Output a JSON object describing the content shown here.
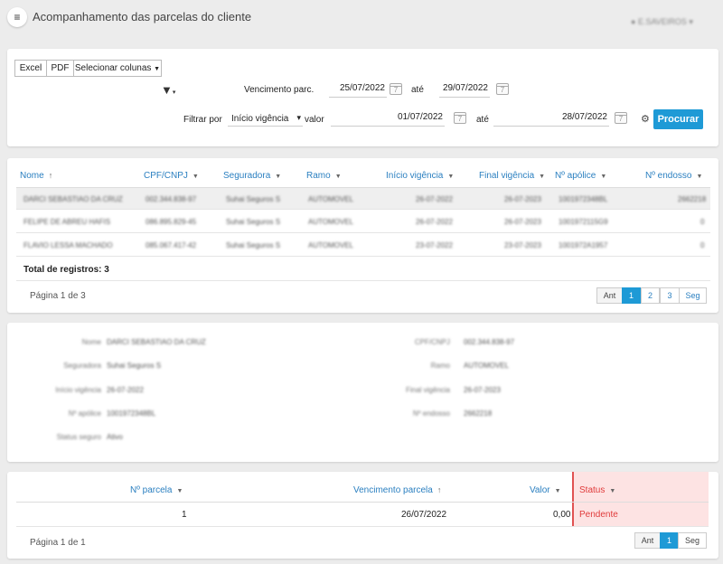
{
  "header": {
    "title": "Acompanhamento das parcelas do cliente",
    "user_name": "E.SAVEIROS"
  },
  "toolbar": {
    "excel_label": "Excel",
    "pdf_label": "PDF",
    "columns_label": "Selecionar colunas"
  },
  "filters": {
    "due_label": "Vencimento parc.",
    "due_from": "25/07/2022",
    "due_to_label": "até",
    "due_to": "29/07/2022",
    "filter_by_label": "Filtrar por",
    "filter_by_value": "Início vigência",
    "value_label": "valor",
    "value_from": "01/07/2022",
    "value_to_label": "até",
    "value_to": "28/07/2022",
    "search_label": "Procurar",
    "calendar_glyph": "7"
  },
  "clients_table": {
    "columns": [
      "Nome",
      "CPF/CNPJ",
      "Seguradora",
      "Ramo",
      "Início vigência",
      "Final vigência",
      "Nº apólice",
      "Nº endosso"
    ],
    "rows": [
      [
        "DARCI SEBASTIAO DA CRUZ",
        "002.344.838-97",
        "Suhai Seguros S",
        "AUTOMOVEL",
        "26-07-2022",
        "26-07-2023",
        "1001972348BL",
        "2662218"
      ],
      [
        "FELIPE DE ABREU HAFIS",
        "086.895.829-45",
        "Suhai Seguros S",
        "AUTOMOVEL",
        "26-07-2022",
        "26-07-2023",
        "1001972115G9",
        "0"
      ],
      [
        "FLAVIO LESSA MACHADO",
        "085.067.417-42",
        "Suhai Seguros S",
        "AUTOMOVEL",
        "23-07-2022",
        "23-07-2023",
        "1001972A1957",
        "0"
      ]
    ],
    "total_label": "Total de registros: 3",
    "page_info": "Página 1 de 3",
    "pagination": [
      "Ant",
      "1",
      "2",
      "3",
      "Seg"
    ]
  },
  "details": {
    "name_label": "Nome",
    "name_value": "DARCI SEBASTIAO DA CRUZ",
    "cpf_label": "CPF/CNPJ",
    "cpf_value": "002.344.838-97",
    "insurer_label": "Seguradora",
    "insurer_value": "Suhai Seguros S",
    "branch_label": "Ramo",
    "branch_value": "AUTOMOVEL",
    "start_label": "Início vigência",
    "start_value": "26-07-2022",
    "end_label": "Final vigência",
    "end_value": "26-07-2023",
    "policy_label": "Nº apólice",
    "policy_value": "1001972348BL",
    "endorsement_label": "Nº endosso",
    "endorsement_value": "2662218",
    "status_label": "Status seguro",
    "status_value": "Ativo"
  },
  "installments_table": {
    "columns": [
      "Nº parcela",
      "Vencimento parcela",
      "Valor",
      "Status"
    ],
    "rows": [
      [
        "1",
        "26/07/2022",
        "0,00",
        "Pendente"
      ]
    ],
    "page_info": "Página 1 de 1",
    "pagination": [
      "Ant",
      "1",
      "Seg"
    ]
  },
  "colors": {
    "accent": "#1e9ad6",
    "header_link": "#2a7fc0",
    "status_bg": "#fde3e3",
    "status_text": "#e03b3b"
  }
}
